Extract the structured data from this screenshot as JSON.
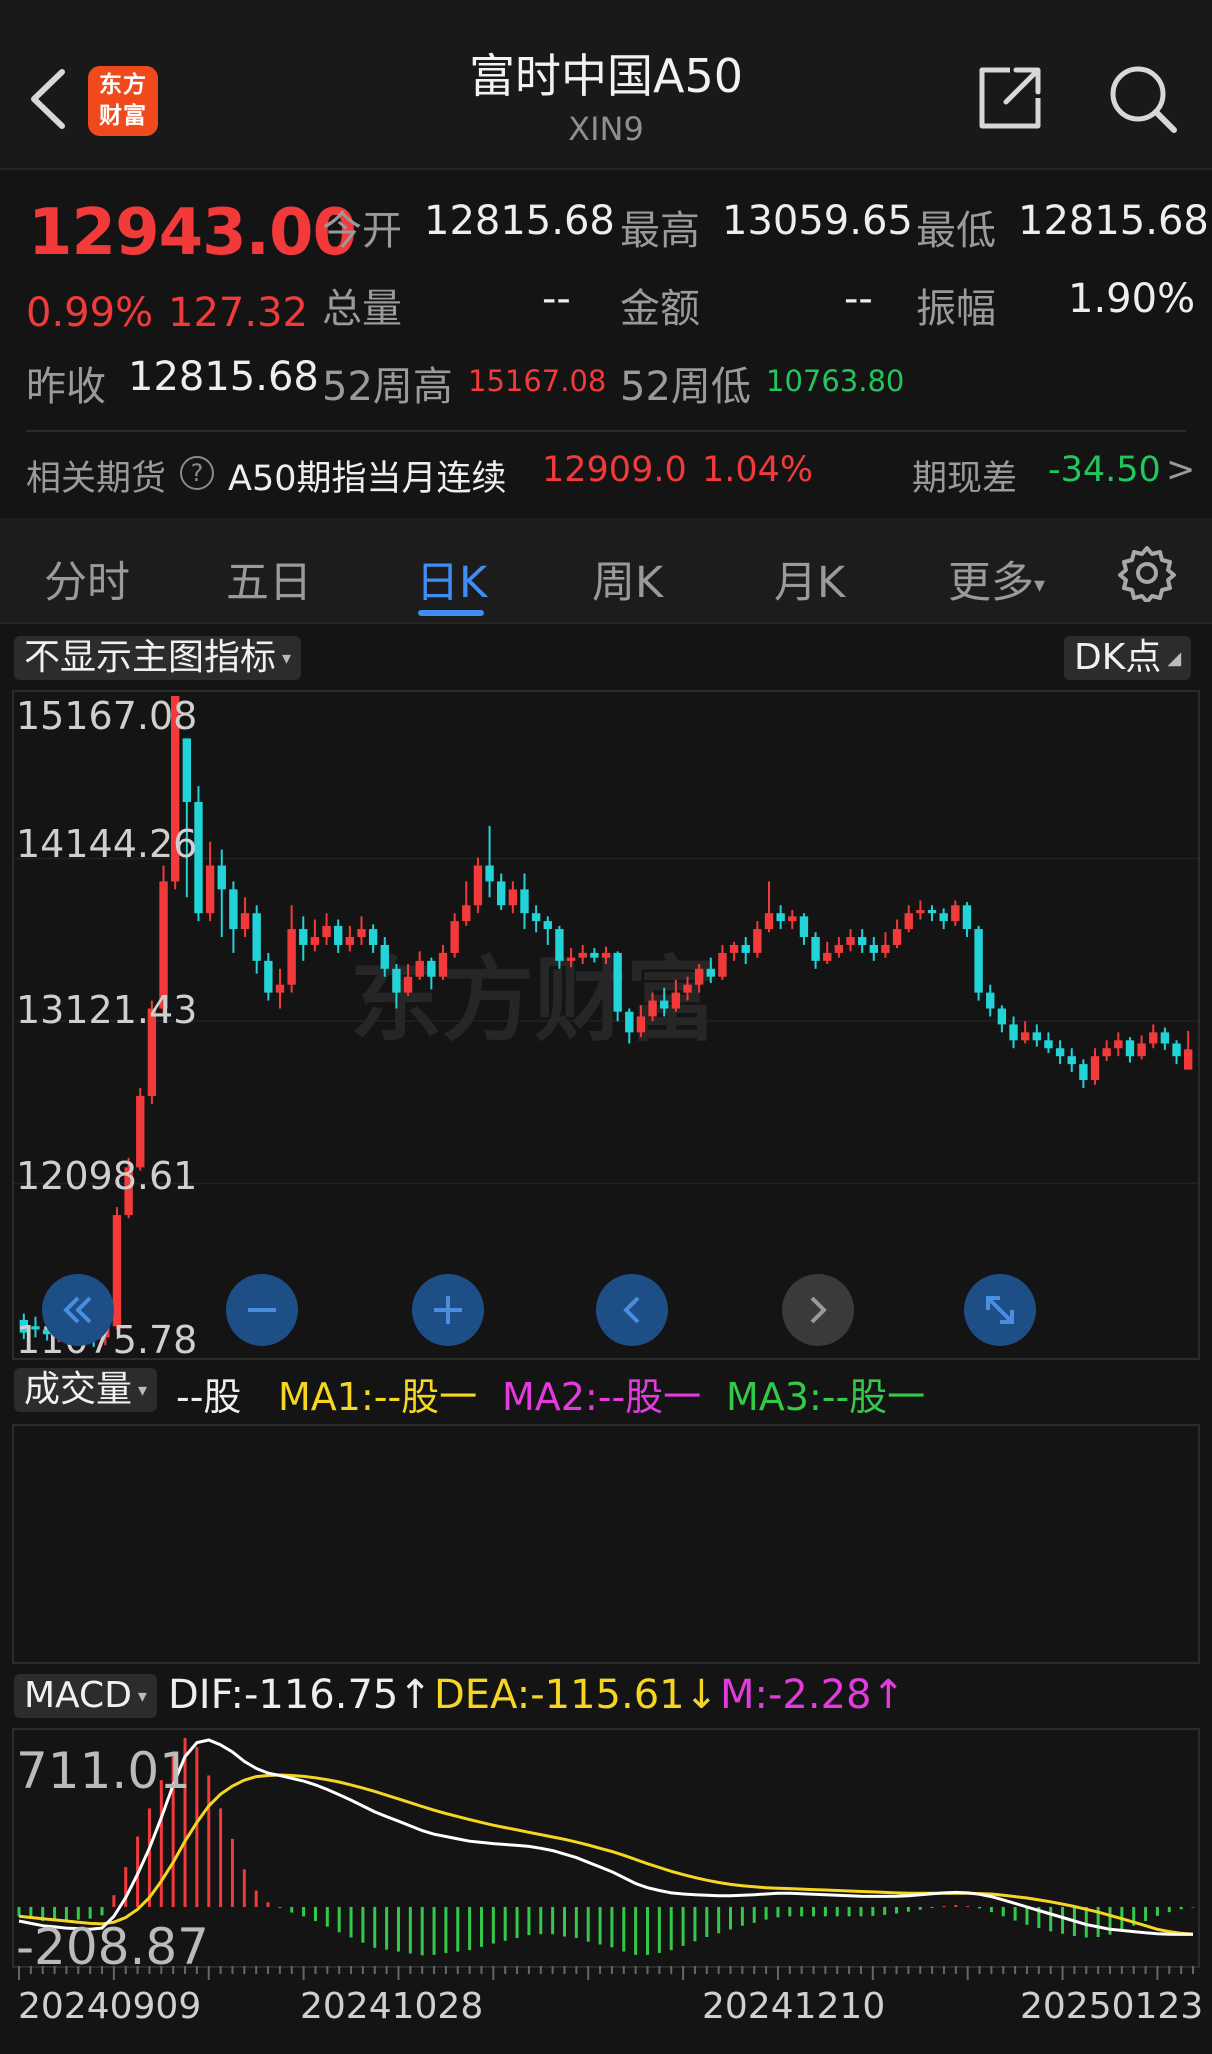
{
  "header": {
    "logo_text_line1": "东方",
    "logo_text_line2": "财富",
    "title": "富时中国A50",
    "subtitle": "XIN9"
  },
  "quote": {
    "price": "12943.00",
    "change_pct": "0.99%",
    "change": "127.32",
    "open_label": "今开",
    "open": "12815.68",
    "high_label": "最高",
    "high": "13059.65",
    "low_label": "最低",
    "low": "12815.68",
    "volume_label": "总量",
    "volume": "--",
    "amount_label": "金额",
    "amount": "--",
    "amplitude_label": "振幅",
    "amplitude": "1.90%",
    "prev_close_label": "昨收",
    "prev_close": "12815.68",
    "wk52_high_label": "52周高",
    "wk52_high": "15167.08",
    "wk52_low_label": "52周低",
    "wk52_low": "10763.80"
  },
  "futures": {
    "label": "相关期货",
    "help_icon": "?",
    "name": "A50期指当月连续",
    "price": "12909.0",
    "pct": "1.04%",
    "basis_label": "期现差",
    "basis": "-34.50",
    "arrow": ">"
  },
  "tabs": [
    {
      "label": "分时"
    },
    {
      "label": "五日"
    },
    {
      "label": "日K"
    },
    {
      "label": "周K"
    },
    {
      "label": "月K"
    },
    {
      "label": "更多"
    }
  ],
  "more_caret": "▾",
  "chart_controls": {
    "indicator_selector": "不显示主图指标",
    "dk_selector": "DK点",
    "watermark": "东方财富"
  },
  "volume_panel": {
    "selector": "成交量",
    "unit": "--股",
    "ma1": "MA1:--股一",
    "ma2": "MA2:--股一",
    "ma3": "MA3:--股一"
  },
  "macd_panel": {
    "selector": "MACD",
    "dif": "DIF:-116.75↑",
    "dea": "DEA:-115.61↓",
    "m": "M:-2.28↑"
  },
  "colors": {
    "up": "#f23a3a",
    "down": "#22d3d8",
    "accent": "#3f8ef5",
    "dif_line": "#ffffff",
    "dea_line": "#f5d623"
  },
  "chart_data": [
    {
      "type": "candlestick",
      "y_ticks": [
        "15167.08",
        "14144.26",
        "13121.43",
        "12098.61",
        "11075.78"
      ],
      "ylim": [
        11075.78,
        15167.08
      ],
      "grid": true,
      "candles": [
        [
          11240,
          11160,
          11280,
          11120
        ],
        [
          11200,
          11180,
          11260,
          11130
        ],
        [
          11180,
          11150,
          11240,
          11110
        ],
        [
          11150,
          11170,
          11230,
          11100
        ],
        [
          11170,
          11140,
          11220,
          11090
        ],
        [
          11140,
          11160,
          11210,
          11080
        ],
        [
          11160,
          11130,
          11200,
          11070
        ],
        [
          11130,
          11200,
          11250,
          11080
        ],
        [
          11200,
          11900,
          11950,
          11180
        ],
        [
          11900,
          12200,
          12260,
          11880
        ],
        [
          12200,
          12650,
          12700,
          12180
        ],
        [
          12650,
          13200,
          13250,
          12600
        ],
        [
          13200,
          14000,
          14100,
          13150
        ],
        [
          14000,
          15167.08,
          15167.08,
          13950
        ],
        [
          14900,
          14500,
          14900,
          13900
        ],
        [
          14500,
          13800,
          14600,
          13750
        ],
        [
          13800,
          14100,
          14250,
          13750
        ],
        [
          14100,
          13950,
          14200,
          13650
        ],
        [
          13950,
          13700,
          14000,
          13550
        ],
        [
          13700,
          13800,
          13900,
          13650
        ],
        [
          13800,
          13500,
          13850,
          13420
        ],
        [
          13500,
          13300,
          13550,
          13250
        ],
        [
          13300,
          13350,
          13450,
          13200
        ],
        [
          13350,
          13700,
          13850,
          13300
        ],
        [
          13700,
          13600,
          13780,
          13500
        ],
        [
          13600,
          13650,
          13760,
          13560
        ],
        [
          13650,
          13720,
          13800,
          13600
        ],
        [
          13720,
          13600,
          13760,
          13550
        ],
        [
          13600,
          13650,
          13720,
          13560
        ],
        [
          13650,
          13700,
          13780,
          13600
        ],
        [
          13700,
          13600,
          13730,
          13550
        ],
        [
          13600,
          13450,
          13650,
          13400
        ],
        [
          13450,
          13300,
          13480,
          13200
        ],
        [
          13300,
          13400,
          13480,
          13280
        ],
        [
          13400,
          13500,
          13560,
          13380
        ],
        [
          13500,
          13400,
          13520,
          13320
        ],
        [
          13400,
          13550,
          13600,
          13380
        ],
        [
          13550,
          13750,
          13800,
          13520
        ],
        [
          13750,
          13850,
          14000,
          13720
        ],
        [
          13850,
          14100,
          14150,
          13800
        ],
        [
          14100,
          14000,
          14350,
          13900
        ],
        [
          14000,
          13850,
          14050,
          13820
        ],
        [
          13850,
          13950,
          14000,
          13800
        ],
        [
          13950,
          13800,
          14050,
          13700
        ],
        [
          13800,
          13750,
          13850,
          13680
        ],
        [
          13750,
          13700,
          13780,
          13600
        ],
        [
          13700,
          13500,
          13720,
          13450
        ],
        [
          13500,
          13520,
          13580,
          13460
        ],
        [
          13520,
          13550,
          13600,
          13480
        ],
        [
          13550,
          13520,
          13580,
          13490
        ],
        [
          13520,
          13550,
          13590,
          13480
        ],
        [
          13550,
          13180,
          13560,
          13120
        ],
        [
          13180,
          13050,
          13200,
          12980
        ],
        [
          13050,
          13150,
          13220,
          13020
        ],
        [
          13150,
          13250,
          13300,
          13120
        ],
        [
          13250,
          13200,
          13330,
          13150
        ],
        [
          13200,
          13300,
          13380,
          13180
        ],
        [
          13300,
          13350,
          13400,
          13250
        ],
        [
          13350,
          13450,
          13480,
          13300
        ],
        [
          13450,
          13400,
          13520,
          13360
        ],
        [
          13400,
          13550,
          13600,
          13380
        ],
        [
          13550,
          13600,
          13620,
          13500
        ],
        [
          13600,
          13550,
          13650,
          13480
        ],
        [
          13550,
          13700,
          13750,
          13520
        ],
        [
          13700,
          13800,
          14000,
          13680
        ],
        [
          13800,
          13750,
          13850,
          13700
        ],
        [
          13750,
          13780,
          13820,
          13700
        ],
        [
          13780,
          13650,
          13800,
          13600
        ],
        [
          13650,
          13500,
          13680,
          13450
        ],
        [
          13500,
          13550,
          13620,
          13480
        ],
        [
          13550,
          13600,
          13650,
          13520
        ],
        [
          13600,
          13650,
          13700,
          13560
        ],
        [
          13650,
          13600,
          13700,
          13550
        ],
        [
          13600,
          13550,
          13650,
          13500
        ],
        [
          13550,
          13600,
          13680,
          13520
        ],
        [
          13600,
          13700,
          13760,
          13580
        ],
        [
          13700,
          13800,
          13850,
          13680
        ],
        [
          13800,
          13820,
          13880,
          13760
        ],
        [
          13820,
          13800,
          13850,
          13750
        ],
        [
          13800,
          13750,
          13830,
          13700
        ],
        [
          13750,
          13850,
          13880,
          13720
        ],
        [
          13850,
          13700,
          13870,
          13650
        ],
        [
          13700,
          13300,
          13720,
          13250
        ],
        [
          13300,
          13200,
          13350,
          13150
        ],
        [
          13200,
          13100,
          13220,
          13050
        ],
        [
          13100,
          13000,
          13150,
          12950
        ],
        [
          13000,
          13050,
          13120,
          12980
        ],
        [
          13050,
          13000,
          13100,
          12960
        ],
        [
          13000,
          12950,
          13050,
          12920
        ],
        [
          12950,
          12900,
          13000,
          12850
        ],
        [
          12900,
          12850,
          12950,
          12800
        ],
        [
          12850,
          12750,
          12880,
          12700
        ],
        [
          12750,
          12900,
          12950,
          12720
        ],
        [
          12900,
          12950,
          13000,
          12870
        ],
        [
          12950,
          13000,
          13050,
          12900
        ],
        [
          13000,
          12900,
          13020,
          12860
        ],
        [
          12900,
          12980,
          13030,
          12880
        ],
        [
          12980,
          13050,
          13100,
          12950
        ],
        [
          13050,
          12980,
          13080,
          12940
        ],
        [
          12980,
          12900,
          13000,
          12850
        ],
        [
          12815.68,
          12943,
          13059.65,
          12815.68
        ]
      ]
    },
    {
      "type": "bar",
      "title": "MACD",
      "y_ticks": [
        "711.01",
        "-208.87"
      ],
      "ylim": [
        -208.87,
        711.01
      ],
      "x_ticks": [
        "20240909",
        "20241028",
        "20241210",
        "20250123"
      ],
      "series": [
        {
          "name": "DIF",
          "values": [
            -60,
            -70,
            -80,
            -85,
            -90,
            -92,
            -95,
            -90,
            -40,
            40,
            140,
            250,
            380,
            520,
            640,
            700,
            711,
            690,
            660,
            620,
            590,
            570,
            560,
            548,
            536,
            520,
            500,
            478,
            455,
            430,
            405,
            385,
            365,
            345,
            325,
            310,
            300,
            290,
            280,
            275,
            270,
            266,
            262,
            258,
            250,
            240,
            225,
            210,
            190,
            170,
            150,
            125,
            100,
            82,
            70,
            60,
            55,
            52,
            50,
            48,
            48,
            50,
            52,
            55,
            58,
            58,
            56,
            54,
            52,
            50,
            48,
            46,
            45,
            45,
            46,
            48,
            52,
            56,
            60,
            62,
            60,
            54,
            44,
            30,
            15,
            0,
            -15,
            -30,
            -45,
            -60,
            -75,
            -85,
            -95,
            -100,
            -105,
            -110,
            -114,
            -116,
            -117,
            -116.75
          ]
        },
        {
          "name": "DEA",
          "values": [
            -40,
            -45,
            -50,
            -55,
            -60,
            -65,
            -70,
            -72,
            -65,
            -45,
            -10,
            40,
            110,
            190,
            280,
            360,
            430,
            480,
            515,
            540,
            555,
            560,
            562,
            560,
            556,
            550,
            542,
            532,
            520,
            506,
            492,
            476,
            460,
            444,
            428,
            412,
            398,
            385,
            372,
            360,
            348,
            338,
            328,
            318,
            308,
            298,
            288,
            276,
            264,
            250,
            236,
            220,
            202,
            184,
            168,
            152,
            138,
            125,
            114,
            104,
            96,
            90,
            86,
            82,
            80,
            78,
            76,
            74,
            72,
            70,
            68,
            66,
            64,
            62,
            60,
            58,
            58,
            58,
            58,
            58,
            58,
            57,
            55,
            50,
            44,
            38,
            30,
            22,
            12,
            2,
            -10,
            -22,
            -36,
            -50,
            -65,
            -80,
            -95,
            -105,
            -112,
            -115.61
          ]
        },
        {
          "name": "M",
          "values": [
            -40,
            -50,
            -60,
            -60,
            -60,
            -54,
            -50,
            -36,
            50,
            170,
            300,
            420,
            540,
            660,
            720,
            680,
            560,
            420,
            290,
            160,
            70,
            20,
            -4,
            -24,
            -40,
            -60,
            -84,
            -108,
            -130,
            -152,
            -174,
            -182,
            -190,
            -198,
            -206,
            -204,
            -196,
            -190,
            -184,
            -170,
            -156,
            -144,
            -132,
            -120,
            -116,
            -116,
            -126,
            -132,
            -148,
            -160,
            -172,
            -190,
            -204,
            -204,
            -196,
            -184,
            -166,
            -146,
            -128,
            -112,
            -96,
            -80,
            -68,
            -54,
            -44,
            -40,
            -40,
            -40,
            -40,
            -40,
            -40,
            -40,
            -38,
            -34,
            -28,
            -20,
            -12,
            -4,
            4,
            8,
            4,
            -6,
            -22,
            -40,
            -58,
            -76,
            -90,
            -104,
            -114,
            -124,
            -130,
            -128,
            -118,
            -100,
            -80,
            -60,
            -38,
            -22,
            -10,
            -2.28
          ]
        }
      ]
    }
  ]
}
